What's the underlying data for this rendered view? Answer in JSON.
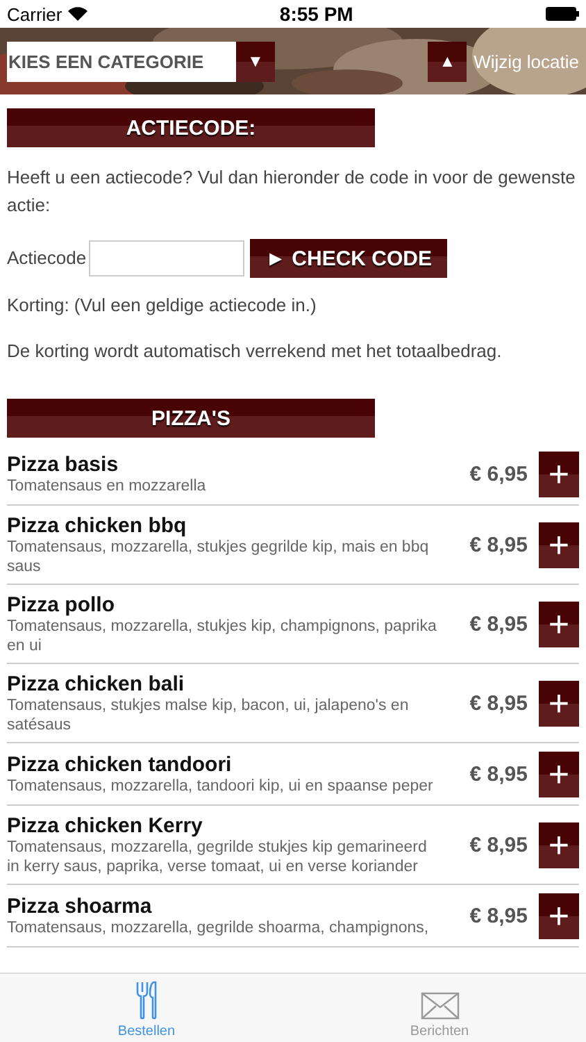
{
  "status_bar": {
    "carrier": "Carrier",
    "time": "8:55 PM"
  },
  "header": {
    "category_select": {
      "value": "KIES EEN CATEGORIE"
    },
    "location_button": {
      "icon": "▲",
      "label": "Wijzig locatie"
    },
    "select_caret": "▼"
  },
  "promo": {
    "heading": "ACTIECODE:",
    "intro": "Heeft u een actiecode? Vul dan hieronder de code in voor de gewenste actie:",
    "field_label": "Actiecode",
    "check_button": "► CHECK CODE",
    "discount": "Korting: (Vul een geldige actiecode in.)",
    "note": "De korting wordt automatisch verrekend met het totaalbedrag."
  },
  "menu": {
    "heading": "PIZZA'S",
    "items": [
      {
        "name": "Pizza basis",
        "description": "Tomatensaus en mozzarella",
        "price": "€ 6,95",
        "add": "+"
      },
      {
        "name": "Pizza chicken bbq",
        "description": "Tomatensaus, mozzarella, stukjes gegrilde kip, mais en bbq saus",
        "price": "€ 8,95",
        "add": "+"
      },
      {
        "name": "Pizza pollo",
        "description": "Tomatensaus, mozzarella, stukjes kip, champignons, paprika en ui",
        "price": "€ 8,95",
        "add": "+"
      },
      {
        "name": "Pizza chicken bali",
        "description": "Tomatensaus, stukjes malse kip, bacon, ui, jalapeno's en satésaus",
        "price": "€ 8,95",
        "add": "+"
      },
      {
        "name": "Pizza chicken tandoori",
        "description": "Tomatensaus, mozzarella, tandoori kip, ui en spaanse peper",
        "price": "€ 8,95",
        "add": "+"
      },
      {
        "name": "Pizza chicken Kerry",
        "description": "Tomatensaus, mozzarella, gegrilde stukjes kip gemarineerd in kerry saus, paprika, verse tomaat, ui en verse koriander",
        "price": "€ 8,95",
        "add": "+"
      },
      {
        "name": "Pizza shoarma",
        "description": "Tomatensaus, mozzarella, gegrilde shoarma, champignons,",
        "price": "€ 8,95",
        "add": "+"
      }
    ]
  },
  "tab_bar": [
    {
      "kind": "cutlery",
      "label": "Bestellen",
      "selected": true
    },
    {
      "kind": "mail",
      "label": "Berichten",
      "selected": false
    }
  ]
}
